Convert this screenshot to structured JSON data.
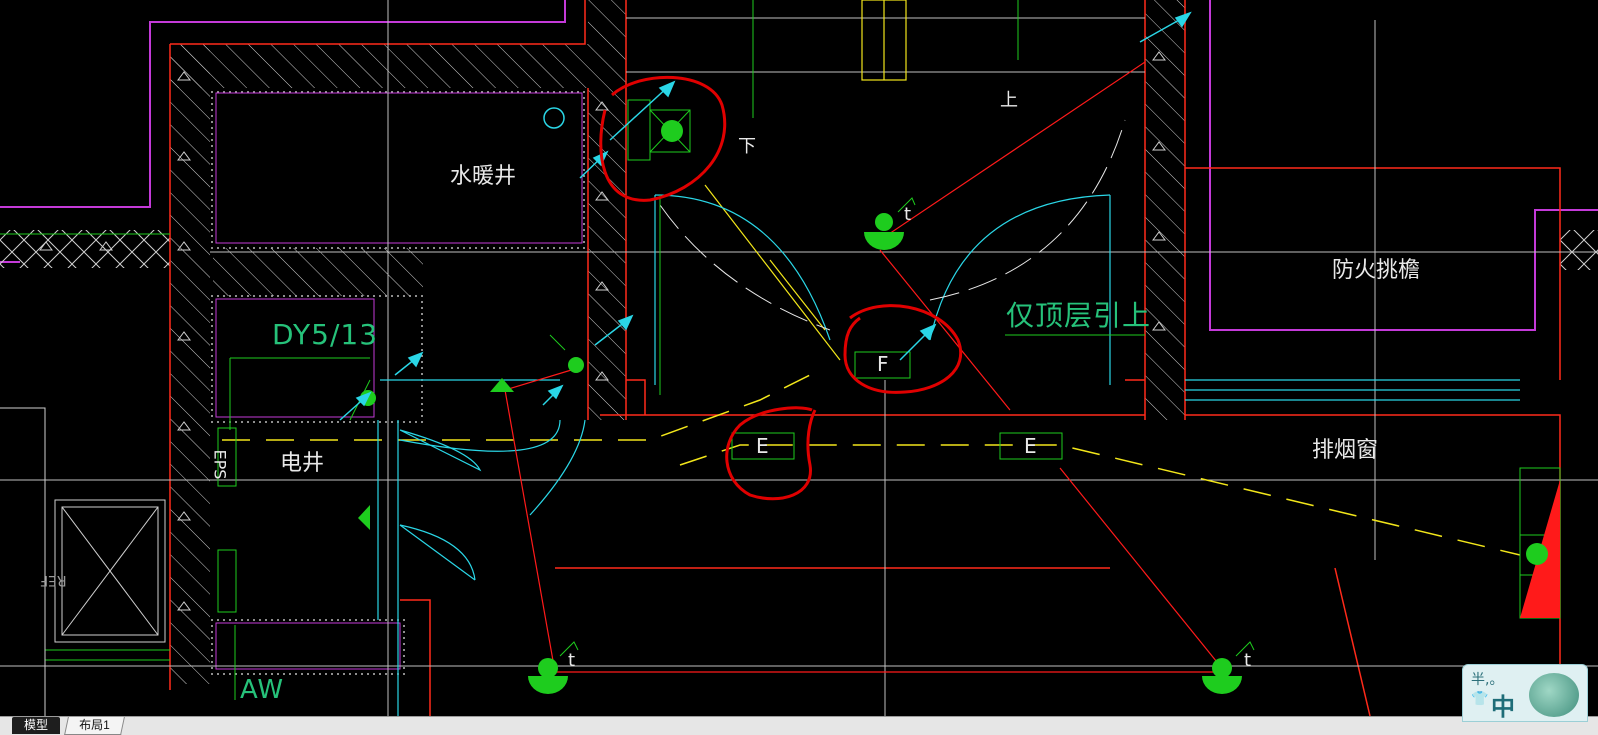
{
  "labels": {
    "shuinuanjing": "水暖井",
    "dy": "DY5/13",
    "dianjing": "电井",
    "eps": "EPS",
    "ref": "REF",
    "aw": "AW",
    "xia": "下",
    "shang": "上",
    "fanghuo": "防火挑檐",
    "yiding": "仅顶层引上",
    "paiyan": "排烟窗",
    "f_box": "F",
    "e_box_1": "E",
    "e_box_2": "E",
    "t1": "t",
    "t2": "t",
    "t3": "t"
  },
  "tabs": {
    "model": "模型",
    "layout1": "布局1"
  },
  "ime": {
    "half": "半,。",
    "lang": "中",
    "shirt_icon": "👕"
  },
  "colors": {
    "wall": "#ff2a1a",
    "hatch": "#d9d9d9",
    "purple": "#c43ad9",
    "yellow": "#f2e61a",
    "cyan": "#2ad6e6",
    "green": "#1ecc1e",
    "annotation": "#e00000"
  }
}
